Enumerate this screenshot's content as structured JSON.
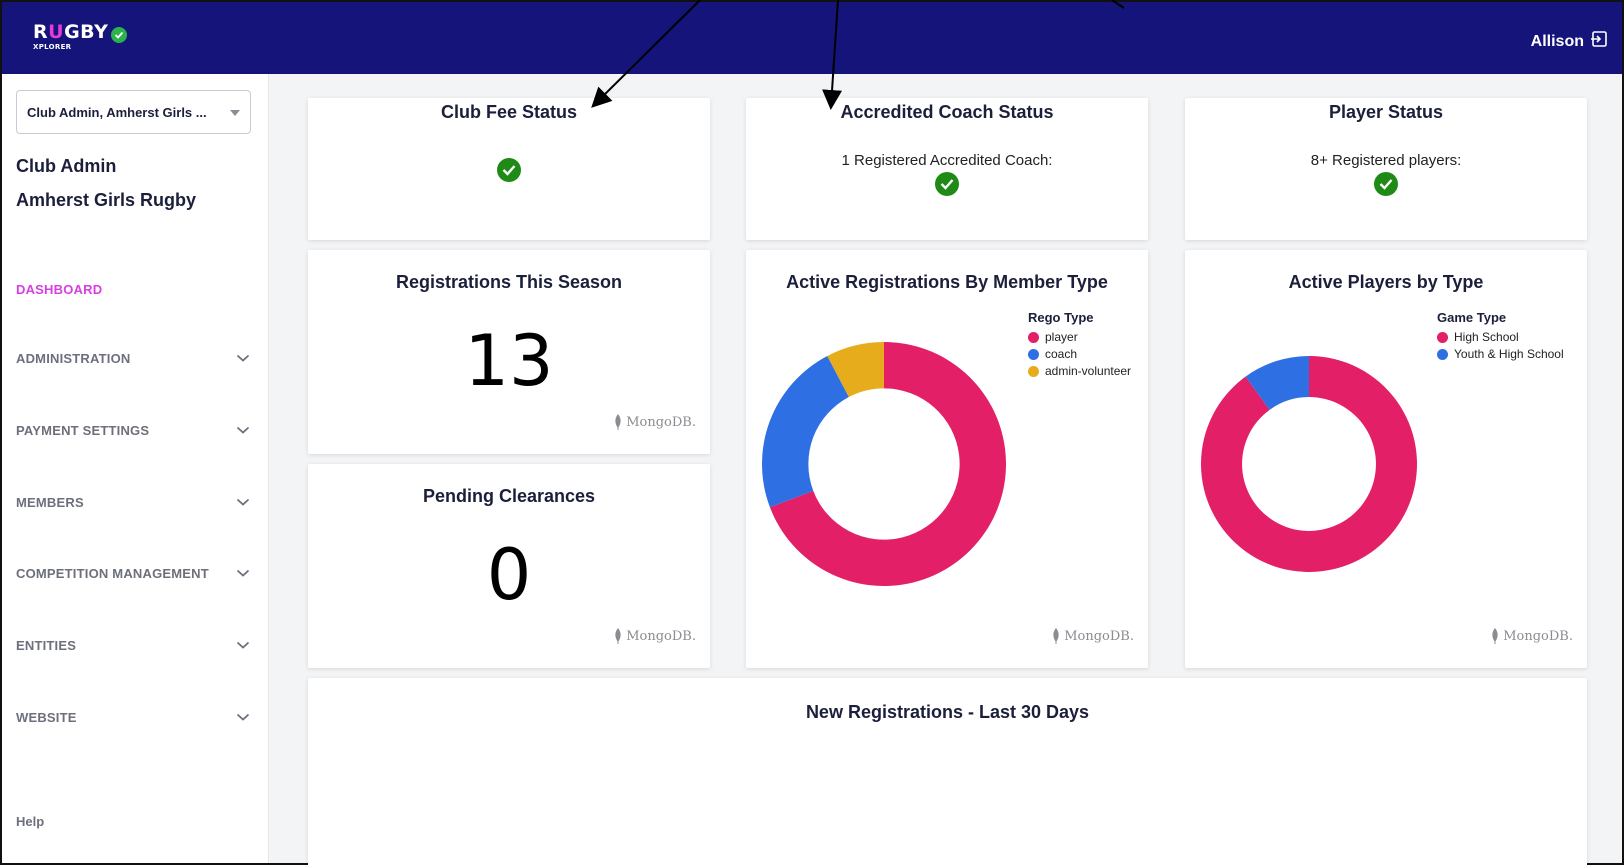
{
  "app": {
    "logo_main_pre": "R",
    "logo_main_u": "U",
    "logo_main_post": "GBY",
    "logo_sub": "XPLORER",
    "user_name": "Allison",
    "logout_icon": "logout-icon"
  },
  "sidebar": {
    "selector_value": "Club Admin, Amherst Girls ...",
    "role": "Club Admin",
    "club": "Amherst Girls Rugby",
    "items": [
      {
        "label": "DASHBOARD",
        "active": true,
        "expandable": false
      },
      {
        "label": "ADMINISTRATION",
        "active": false,
        "expandable": true
      },
      {
        "label": "PAYMENT SETTINGS",
        "active": false,
        "expandable": true
      },
      {
        "label": "MEMBERS",
        "active": false,
        "expandable": true
      },
      {
        "label": "COMPETITION MANAGEMENT",
        "active": false,
        "expandable": true
      },
      {
        "label": "ENTITIES",
        "active": false,
        "expandable": true
      },
      {
        "label": "WEBSITE",
        "active": false,
        "expandable": true
      }
    ],
    "help": "Help"
  },
  "cards": {
    "club_fee": {
      "title": "Club Fee Status",
      "status": "ok"
    },
    "coach": {
      "title": "Accredited Coach Status",
      "text": "1 Registered Accredited Coach:",
      "status": "ok"
    },
    "player": {
      "title": "Player Status",
      "text": "8+ Registered players:",
      "status": "ok"
    },
    "registrations": {
      "title": "Registrations This Season",
      "value": "13",
      "watermark": "MongoDB."
    },
    "clearances": {
      "title": "Pending Clearances",
      "value": "0",
      "watermark": "MongoDB."
    },
    "member_type": {
      "title": "Active Registrations By Member Type",
      "watermark": "MongoDB."
    },
    "players_type": {
      "title": "Active Players by Type",
      "watermark": "MongoDB."
    },
    "new_regs": {
      "title": "New Registrations - Last 30 Days"
    }
  },
  "chart_data": [
    {
      "type": "pie",
      "title": "Active Registrations By Member Type",
      "legend_title": "Rego Type",
      "legend_position": "top-right",
      "donut": true,
      "categories": [
        "player",
        "coach",
        "admin-volunteer"
      ],
      "values": [
        9,
        3,
        1
      ],
      "colors": [
        "#e21f67",
        "#2f6fe4",
        "#e6ac1c"
      ]
    },
    {
      "type": "pie",
      "title": "Active Players by Type",
      "legend_title": "Game Type",
      "legend_position": "top-right",
      "donut": true,
      "categories": [
        "High School",
        "Youth & High School"
      ],
      "values": [
        9,
        1
      ],
      "colors": [
        "#e21f67",
        "#2f6fe4"
      ]
    }
  ],
  "colors": {
    "topbar": "#14147a",
    "accent": "#d63fe0",
    "ok": "#1f8a16"
  }
}
